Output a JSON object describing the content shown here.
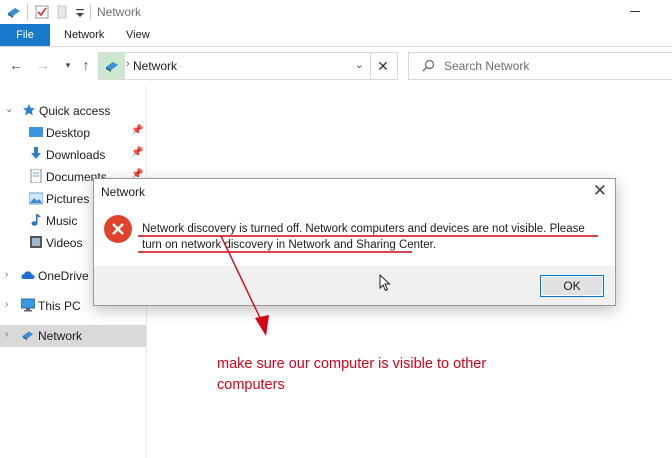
{
  "window": {
    "title": "Network"
  },
  "ribbon": {
    "tabs": [
      "File",
      "Network",
      "View"
    ]
  },
  "address_bar": {
    "location": "Network"
  },
  "search": {
    "placeholder": "Search Network"
  },
  "sidebar": {
    "items": [
      {
        "label": "Quick access",
        "icon": "star-icon",
        "pinned": false
      },
      {
        "label": "Desktop",
        "icon": "desktop-icon",
        "pinned": true
      },
      {
        "label": "Downloads",
        "icon": "download-icon",
        "pinned": true
      },
      {
        "label": "Documents",
        "icon": "documents-icon",
        "pinned": true
      },
      {
        "label": "Pictures",
        "icon": "pictures-icon",
        "pinned": false
      },
      {
        "label": "Music",
        "icon": "music-icon",
        "pinned": false
      },
      {
        "label": "Videos",
        "icon": "videos-icon",
        "pinned": false
      },
      {
        "label": "OneDrive",
        "icon": "cloud-icon",
        "pinned": false
      },
      {
        "label": "This PC",
        "icon": "computer-icon",
        "pinned": false
      },
      {
        "label": "Network",
        "icon": "network-icon",
        "pinned": false,
        "selected": true
      }
    ]
  },
  "dialog": {
    "title": "Network",
    "message": "Network discovery is turned off. Network computers and devices are not visible. Please turn on network discovery in Network and Sharing Center.",
    "ok_label": "OK",
    "icon": "error-icon"
  },
  "annotation": {
    "text": "make sure our computer is visible to other computers",
    "color": "#d4001a"
  },
  "colors": {
    "accent": "#1979ca",
    "selection": "#d9d9d9",
    "error": "#e0432c"
  }
}
